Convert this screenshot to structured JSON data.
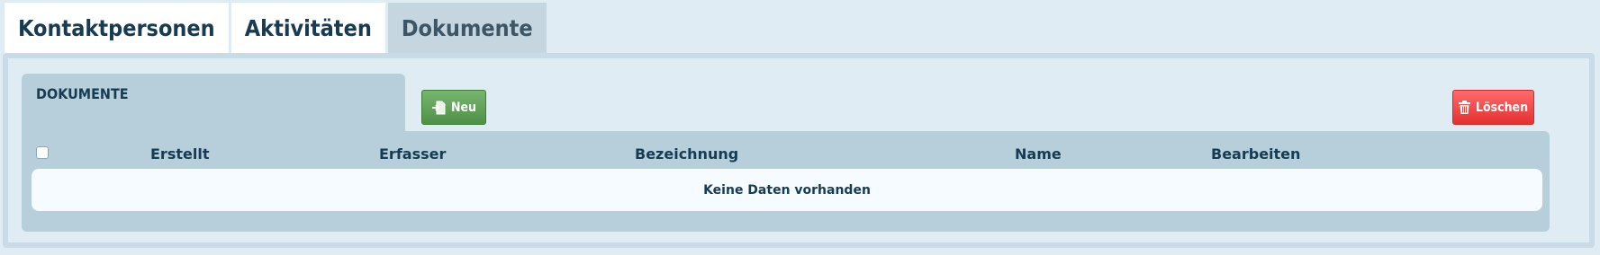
{
  "tabs": [
    {
      "label": "Kontaktpersonen"
    },
    {
      "label": "Aktivitäten"
    },
    {
      "label": "Dokumente"
    }
  ],
  "active_tab": "Dokumente",
  "section": {
    "title": "DOKUMENTE"
  },
  "toolbar": {
    "new_label": "Neu",
    "delete_label": "Löschen",
    "new_icon": "new-document-icon",
    "delete_icon": "trash-icon"
  },
  "table": {
    "columns": [
      "Erstellt",
      "Erfasser",
      "Bezeichnung",
      "Name",
      "Bearbeiten"
    ],
    "empty_text": "Keine Daten vorhanden"
  },
  "colors": {
    "background": "#dfecf4",
    "header_band": "#b6cfdb",
    "text": "#173b53",
    "new_button": "#5a9e53",
    "delete_button": "#f04545"
  }
}
